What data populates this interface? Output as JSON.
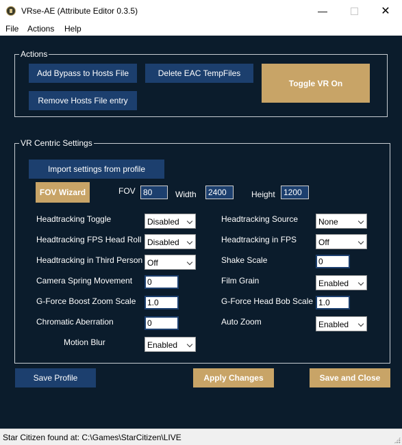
{
  "window": {
    "title": "VRse-AE (Attribute Editor 0.3.5)",
    "minimize_glyph": "—",
    "close_glyph": "✕"
  },
  "menu": {
    "items": [
      "File",
      "Actions",
      "Help"
    ]
  },
  "actions_group": {
    "legend": "Actions",
    "add_bypass": "Add Bypass to Hosts File",
    "delete_eac": "Delete EAC TempFiles",
    "toggle_vr": "Toggle VR On",
    "remove_hosts": "Remove Hosts File entry"
  },
  "vr_group": {
    "legend": "VR Centric Settings",
    "import_profile": "Import settings from profile",
    "fov_wizard": "FOV Wizard",
    "fov_label": "FOV",
    "fov_value": "80",
    "width_label": "Width",
    "width_value": "2400",
    "height_label": "Height",
    "height_value": "1200",
    "settings": {
      "headtracking_toggle": {
        "label": "Headtracking Toggle",
        "value": "Disabled"
      },
      "headtracking_fps_head_roll": {
        "label": "Headtracking FPS Head Roll",
        "value": "Disabled"
      },
      "headtracking_third_person": {
        "label": "Headtracking in Third Person",
        "value": "Off"
      },
      "camera_spring_movement": {
        "label": "Camera Spring Movement",
        "value": "0"
      },
      "gforce_boost_zoom_scale": {
        "label": "G-Force Boost Zoom Scale",
        "value": "1.0"
      },
      "chromatic_aberration": {
        "label": "Chromatic Aberration",
        "value": "0"
      },
      "motion_blur": {
        "label": "Motion Blur",
        "value": "Enabled"
      },
      "headtracking_source": {
        "label": "Headtracking Source",
        "value": "None"
      },
      "headtracking_in_fps": {
        "label": "Headtracking in FPS",
        "value": "Off"
      },
      "shake_scale": {
        "label": "Shake Scale",
        "value": "0"
      },
      "film_grain": {
        "label": "Film Grain",
        "value": "Enabled"
      },
      "gforce_head_bob_scale": {
        "label": "G-Force Head Bob Scale",
        "value": "1.0"
      },
      "auto_zoom": {
        "label": "Auto Zoom",
        "value": "Enabled"
      }
    }
  },
  "footer": {
    "save_profile": "Save Profile",
    "apply_changes": "Apply Changes",
    "save_and_close": "Save and Close"
  },
  "status": {
    "text": "Star Citizen found at: C:\\Games\\StarCitizen\\LIVE"
  },
  "colors": {
    "background": "#0b1c2c",
    "button_blue": "#1c3f6e",
    "button_gold": "#c8a467"
  }
}
